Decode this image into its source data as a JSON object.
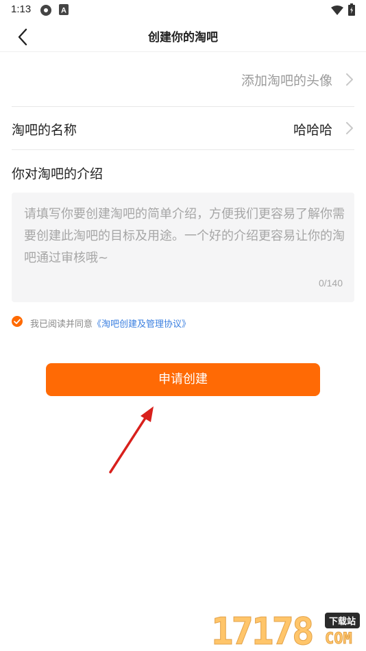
{
  "status_bar": {
    "time": "1:13",
    "left_icons": [
      "settings-icon",
      "a-icon"
    ],
    "right_icons": [
      "wifi-icon",
      "battery-icon"
    ]
  },
  "nav": {
    "title": "创建你的淘吧",
    "back_icon": "chevron-left-icon"
  },
  "avatar_row": {
    "label": "添加淘吧的头像",
    "icon": "chevron-right-icon"
  },
  "name_row": {
    "label": "淘吧的名称",
    "value": "哈哈哈",
    "icon": "chevron-right-icon"
  },
  "intro": {
    "label": "你对淘吧的介绍",
    "placeholder": "请填写你要创建淘吧的简单介绍，方便我们更容易了解你需要创建此淘吧的目标及用途。一个好的介绍更容易让你的淘吧通过审核哦~",
    "counter": "0/140"
  },
  "agreement": {
    "checked": true,
    "prefix": "我已阅读并同意",
    "link": "《淘吧创建及管理协议》"
  },
  "submit": {
    "label": "申请创建"
  },
  "watermark": {
    "number": "17178",
    "tag": "下载站",
    "domain": "COM"
  },
  "colors": {
    "accent": "#ff6a05",
    "link": "#3a7fe0",
    "placeholder": "#a6a6a6",
    "annotation_arrow": "#d8201c"
  }
}
